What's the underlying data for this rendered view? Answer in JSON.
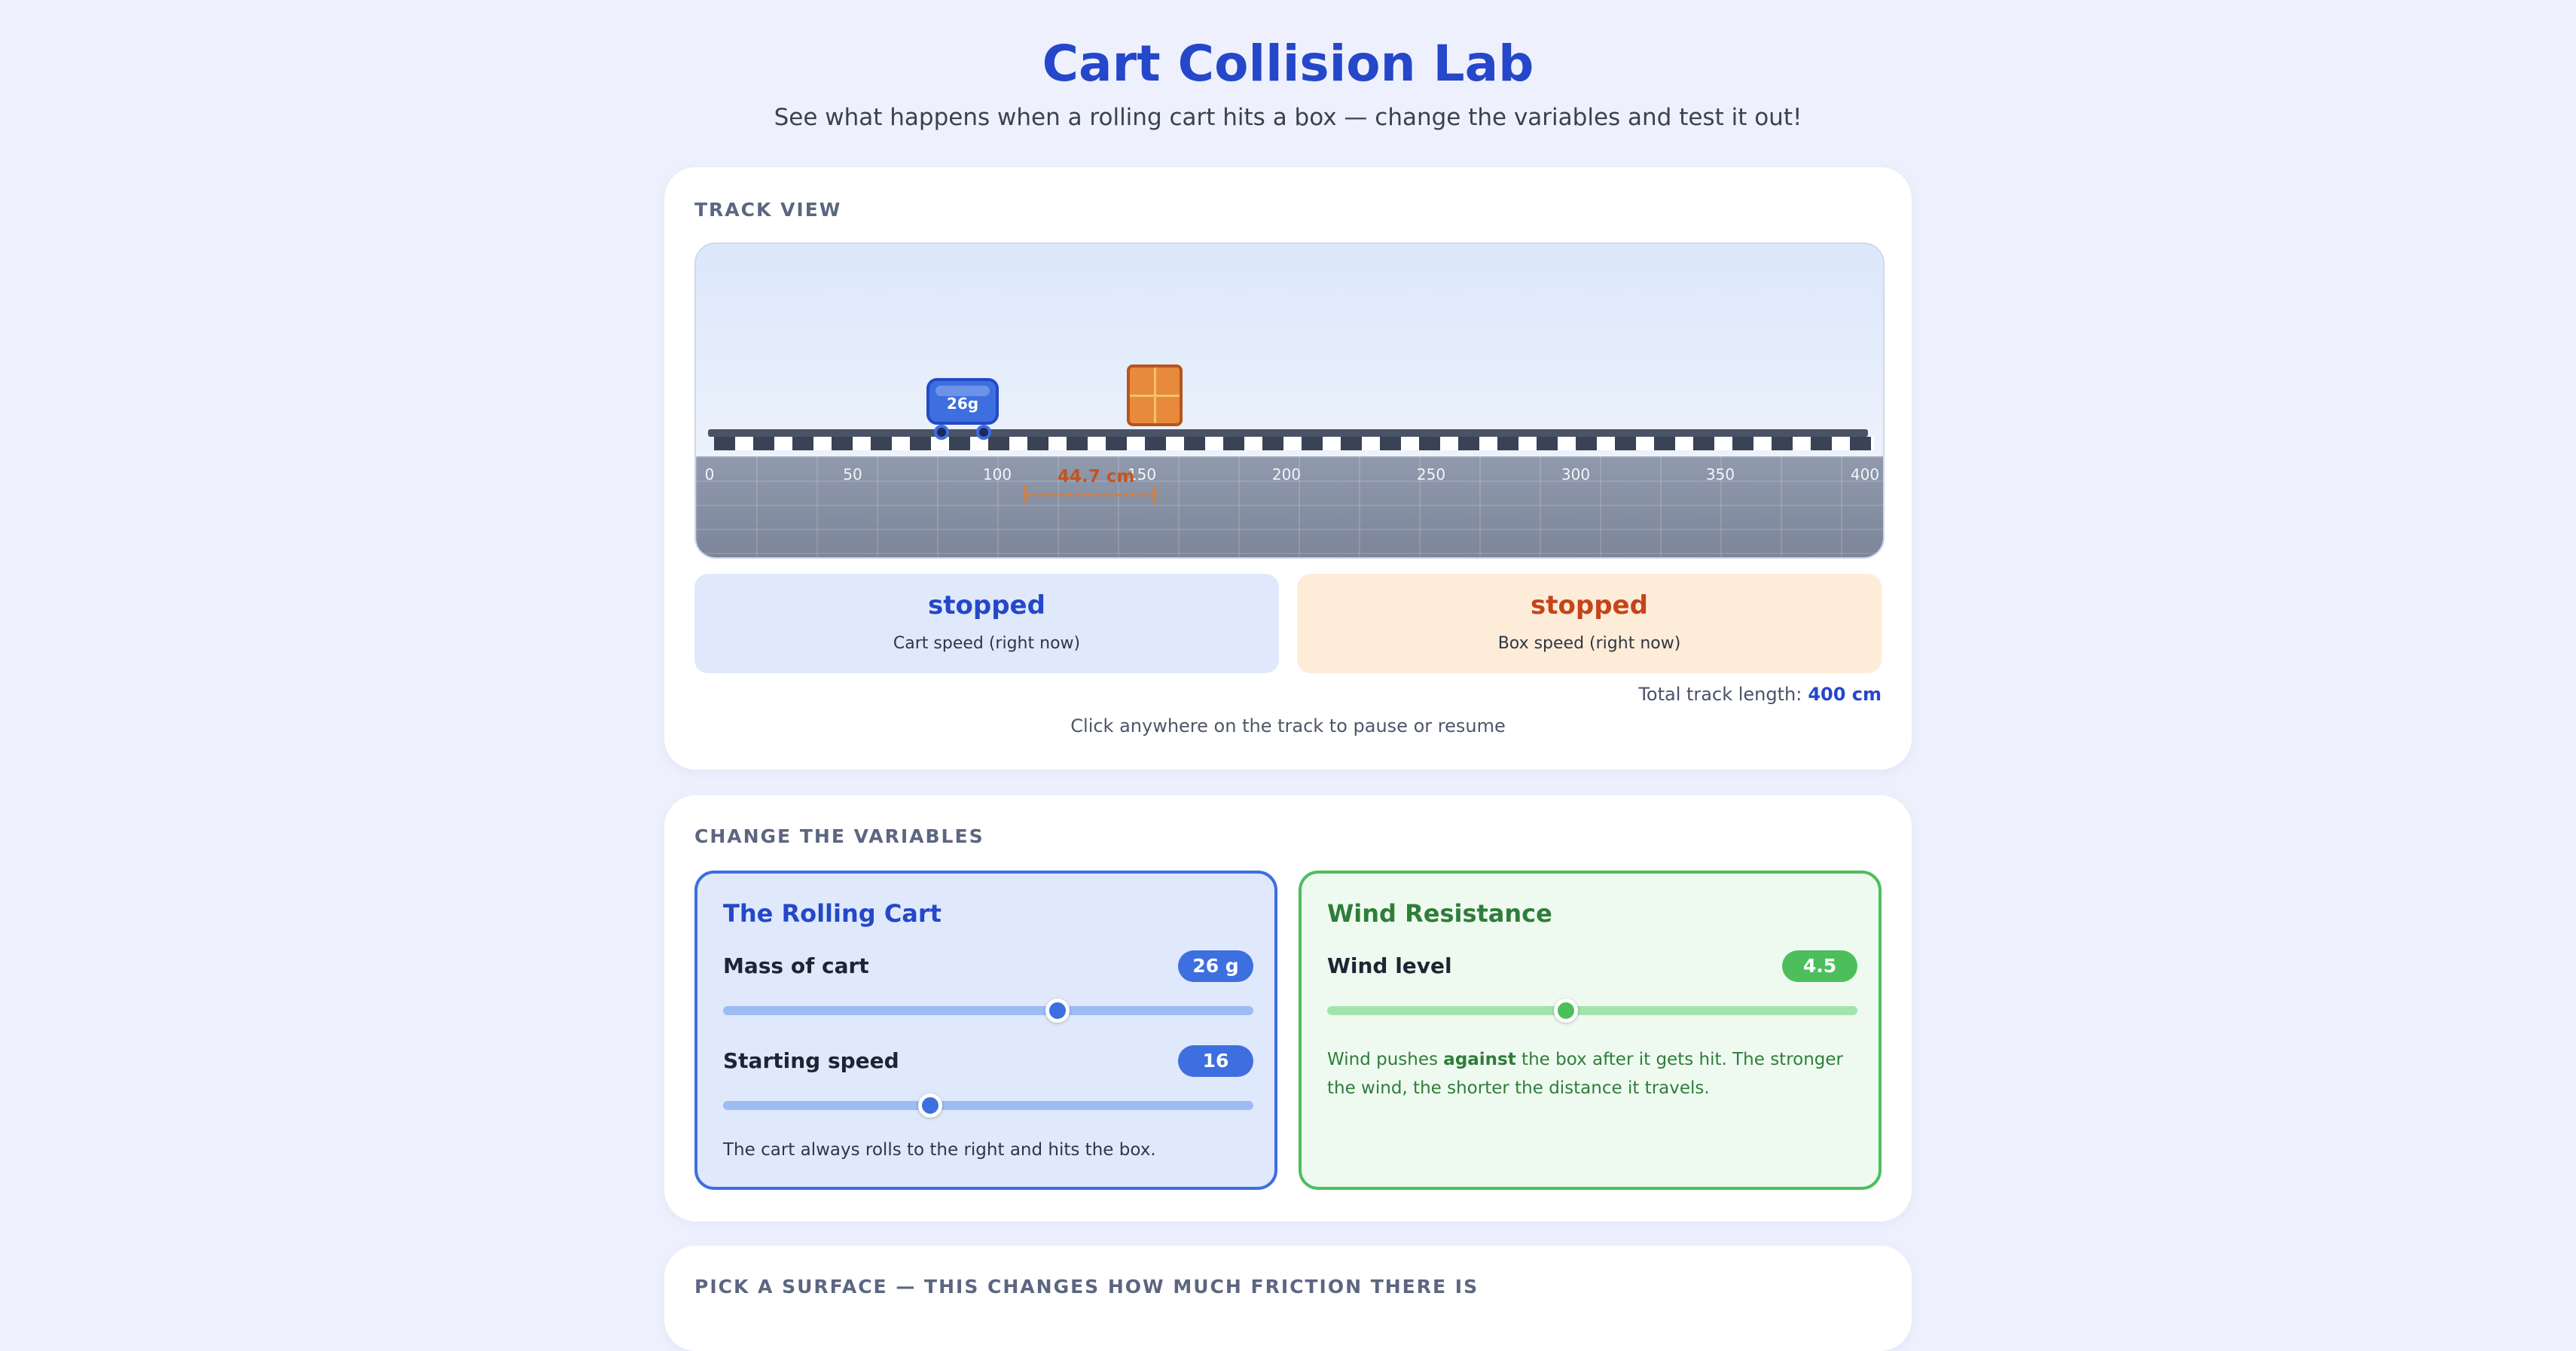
{
  "header": {
    "title": "Cart Collision Lab",
    "subtitle": "See what happens when a rolling cart hits a box — change the variables and test it out!"
  },
  "track_view": {
    "label": "TRACK VIEW",
    "tick_labels": [
      "0",
      "50",
      "100",
      "150",
      "200",
      "250",
      "300",
      "350",
      "400"
    ],
    "cart_label": "26g",
    "distance_label": "44.7 cm",
    "cart_speed": {
      "value": "stopped",
      "caption": "Cart speed (right now)"
    },
    "box_speed": {
      "value": "stopped",
      "caption": "Box speed (right now)"
    },
    "track_length_label": "Total track length:",
    "track_length_value": "400 cm",
    "hint": "Click anywhere on the track to pause or resume"
  },
  "variables": {
    "label": "CHANGE THE VARIABLES",
    "cart_panel": {
      "title": "The Rolling Cart",
      "mass": {
        "label": "Mass of cart",
        "value": "26 g",
        "fraction": 0.63
      },
      "speed": {
        "label": "Starting speed",
        "value": "16",
        "fraction": 0.39
      },
      "note": "The cart always rolls to the right and hits the box."
    },
    "wind_panel": {
      "title": "Wind Resistance",
      "wind": {
        "label": "Wind level",
        "value": "4.5",
        "fraction": 0.45
      },
      "note_before": "Wind pushes ",
      "note_bold": "against",
      "note_after": " the box after it gets hit. The stronger the wind, the shorter the distance it travels."
    }
  },
  "surface": {
    "label": "PICK A SURFACE — THIS CHANGES HOW MUCH FRICTION THERE IS"
  },
  "colors": {
    "accent_blue": "#2547c9",
    "cart_blue": "#3d6fe0",
    "box_orange": "#e88a3c",
    "wind_green": "#4cbf5c",
    "cart_panel_bg": "#dfe9fb",
    "box_panel_bg": "#fdecd8",
    "wind_panel_bg": "#eefaf0"
  }
}
